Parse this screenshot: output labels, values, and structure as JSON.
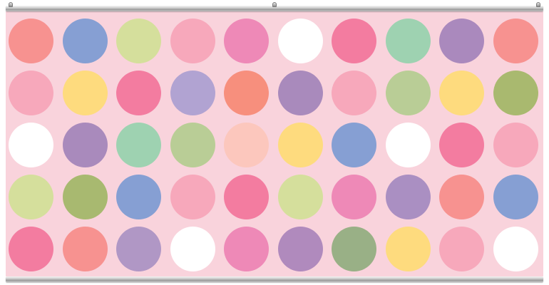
{
  "banner": {
    "background_color": "#f9d3dc",
    "rail_color": "#b8b8b8",
    "dot_rows": [
      [
        "#f79290",
        "#869fd3",
        "#d5df9c",
        "#f7a8bb",
        "#ee89b7",
        "#ffffff",
        "#f37ca0",
        "#9ed2b1",
        "#aa89bd",
        "#f79290"
      ],
      [
        "#f7a8bb",
        "#fedb7e",
        "#f37ca0",
        "#b1a3d2",
        "#f78f7d",
        "#a98abc",
        "#f7a8bb",
        "#b9cd96",
        "#fedb7e",
        "#a9b96f"
      ],
      [
        "#ffffff",
        "#a98abc",
        "#9ed2b1",
        "#b9cd96",
        "#fcc7bd",
        "#fedb7e",
        "#869fd3",
        "#ffffff",
        "#f37ca0",
        "#f7a8bb"
      ],
      [
        "#d5df9c",
        "#a8b970",
        "#869fd3",
        "#f7a8bb",
        "#f37ca0",
        "#d5df9c",
        "#ee89b7",
        "#aa8fc2",
        "#f79290",
        "#869fd3"
      ],
      [
        "#f37ca0",
        "#f79290",
        "#b097c5",
        "#ffffff",
        "#ee89b7",
        "#b08abd",
        "#99b086",
        "#fedb7e",
        "#f7a8bb",
        "#ffffff"
      ]
    ]
  }
}
